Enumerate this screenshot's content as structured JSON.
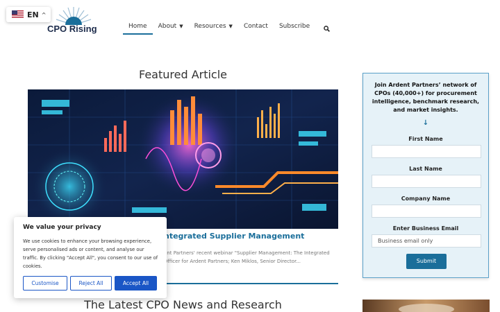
{
  "language": {
    "code": "EN"
  },
  "logo": {
    "text": "CPO Rising"
  },
  "nav": {
    "items": [
      {
        "label": "Home"
      },
      {
        "label": "About"
      },
      {
        "label": "Resources"
      },
      {
        "label": "Contact"
      },
      {
        "label": "Subscribe"
      }
    ]
  },
  "featured": {
    "heading": "Featured Article",
    "article_title": "ntegrated Supplier Management",
    "excerpt": "ent Partners' recent webinar \"Supplier Management: The Integrated Officer for Ardent Partners; Ken Miklos, Senior Director..."
  },
  "latest": {
    "heading": "The Latest CPO News and Research"
  },
  "signup": {
    "intro": "Join Ardent Partners’ network of CPOs (40,000+) for procurement intelligence, benchmark research, and market insights.",
    "arrow": "↓",
    "first_name_label": "First Name",
    "last_name_label": "Last Name",
    "company_label": "Company Name",
    "email_label": "Enter Business Email",
    "email_placeholder": "Business email only",
    "submit_label": "Submit"
  },
  "cookie": {
    "title": "We value your privacy",
    "body": "We use cookies to enhance your browsing experience, serve personalised ads or content, and analyse our traffic. By clicking \"Accept All\", you consent to our use of cookies.",
    "customise": "Customise",
    "reject": "Reject All",
    "accept": "Accept All"
  },
  "colors": {
    "accent": "#1a6e9a",
    "cookie_blue": "#1a56c6",
    "signup_bg": "#e6f2f8"
  }
}
